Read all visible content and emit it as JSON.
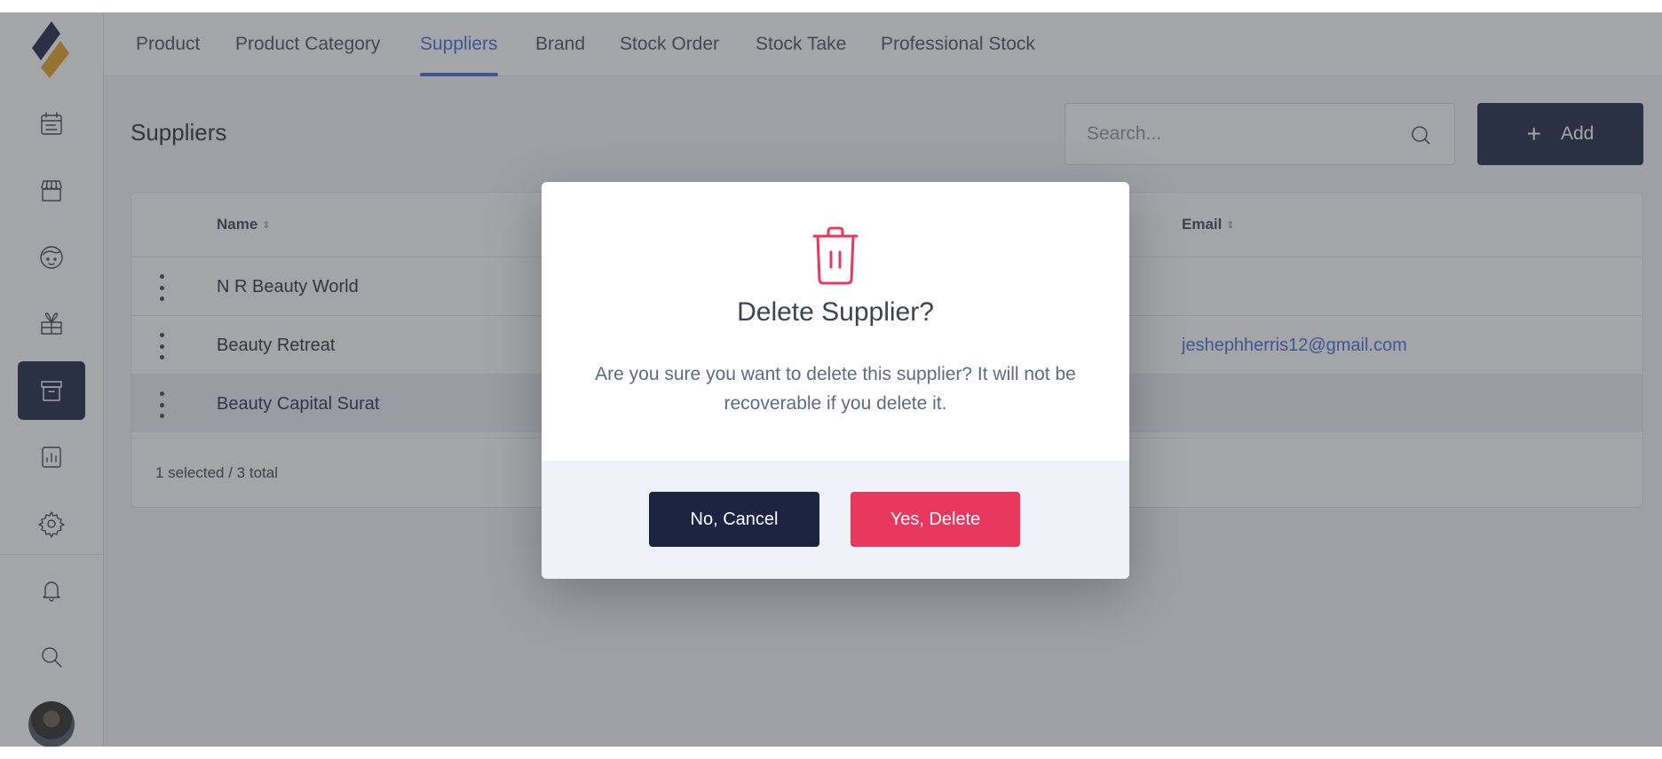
{
  "tabs": [
    {
      "label": "Product",
      "active": false
    },
    {
      "label": "Product Category",
      "active": false
    },
    {
      "label": "Suppliers",
      "active": true
    },
    {
      "label": "Brand",
      "active": false
    },
    {
      "label": "Stock Order",
      "active": false
    },
    {
      "label": "Stock Take",
      "active": false
    },
    {
      "label": "Professional Stock",
      "active": false
    }
  ],
  "sidebar": {
    "logo": "brand-logo",
    "items": [
      {
        "icon": "calendar-icon",
        "active": false
      },
      {
        "icon": "store-icon",
        "active": false
      },
      {
        "icon": "face-icon",
        "active": false
      },
      {
        "icon": "gift-icon",
        "active": false
      },
      {
        "icon": "archive-icon",
        "active": true
      },
      {
        "icon": "report-icon",
        "active": false
      },
      {
        "icon": "gear-icon",
        "active": false
      },
      {
        "icon": "bell-icon",
        "active": false
      },
      {
        "icon": "search-icon",
        "active": false
      }
    ],
    "avatar": "user-avatar"
  },
  "page": {
    "title": "Suppliers",
    "search_placeholder": "Search...",
    "add_label": "Add"
  },
  "table": {
    "columns": {
      "name": "Name",
      "email": "Email"
    },
    "rows": [
      {
        "name": "N R Beauty World",
        "email": "",
        "selected": false
      },
      {
        "name": "Beauty Retreat",
        "email": "jeshephherris12@gmail.com",
        "selected": false
      },
      {
        "name": "Beauty Capital Surat",
        "email": "",
        "selected": true
      }
    ],
    "footer": "1 selected / 3 total"
  },
  "modal": {
    "icon": "trash-icon",
    "title": "Delete Supplier?",
    "message": "Are you sure you want to delete this supplier? It will not be recoverable if you delete it.",
    "cancel_label": "No, Cancel",
    "confirm_label": "Yes, Delete"
  },
  "colors": {
    "accent": "#3b6fd8",
    "navy": "#1b2440",
    "danger": "#e8385e"
  }
}
